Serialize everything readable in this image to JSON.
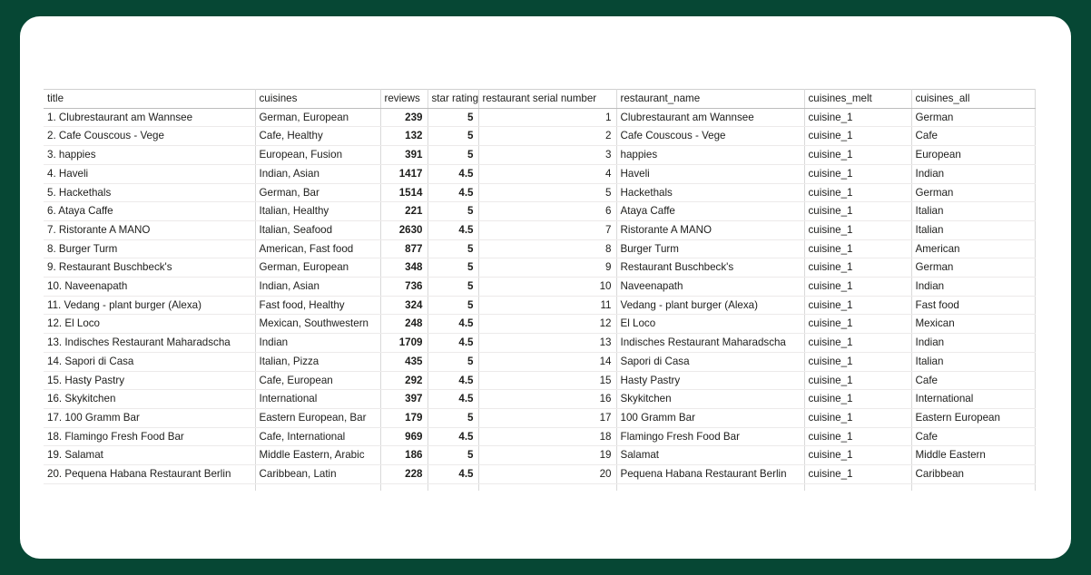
{
  "background": {
    "page_color": "#064734",
    "card_color": "#ffffff"
  },
  "spreadsheet": {
    "columns": [
      {
        "key": "title",
        "label": "title",
        "align": "left"
      },
      {
        "key": "cuisines",
        "label": "cuisines",
        "align": "left"
      },
      {
        "key": "reviews",
        "label": "reviews",
        "align": "right"
      },
      {
        "key": "star_rating",
        "label": "star rating",
        "align": "right"
      },
      {
        "key": "restaurant_serial_number",
        "label": "restaurant serial number",
        "align": "right"
      },
      {
        "key": "restaurant_name",
        "label": "restaurant_name",
        "align": "left"
      },
      {
        "key": "cuisines_melt",
        "label": "cuisines_melt",
        "align": "left"
      },
      {
        "key": "cuisines_all",
        "label": "cuisines_all",
        "align": "left"
      }
    ],
    "rows": [
      {
        "title": "1. Clubrestaurant am Wannsee",
        "cuisines": "German, European",
        "reviews": "239",
        "star_rating": "5",
        "restaurant_serial_number": "1",
        "restaurant_name": "Clubrestaurant am Wannsee",
        "cuisines_melt": "cuisine_1",
        "cuisines_all": "German"
      },
      {
        "title": "2. Cafe Couscous - Vege",
        "cuisines": "Cafe, Healthy",
        "reviews": "132",
        "star_rating": "5",
        "restaurant_serial_number": "2",
        "restaurant_name": "Cafe Couscous - Vege",
        "cuisines_melt": "cuisine_1",
        "cuisines_all": "Cafe"
      },
      {
        "title": "3. happies",
        "cuisines": "European, Fusion",
        "reviews": "391",
        "star_rating": "5",
        "restaurant_serial_number": "3",
        "restaurant_name": "happies",
        "cuisines_melt": "cuisine_1",
        "cuisines_all": "European"
      },
      {
        "title": "4. Haveli",
        "cuisines": "Indian, Asian",
        "reviews": "1417",
        "star_rating": "4.5",
        "restaurant_serial_number": "4",
        "restaurant_name": "Haveli",
        "cuisines_melt": "cuisine_1",
        "cuisines_all": "Indian"
      },
      {
        "title": "5. Hackethals",
        "cuisines": "German, Bar",
        "reviews": "1514",
        "star_rating": "4.5",
        "restaurant_serial_number": "5",
        "restaurant_name": "Hackethals",
        "cuisines_melt": "cuisine_1",
        "cuisines_all": "German"
      },
      {
        "title": "6. Ataya Caffe",
        "cuisines": "Italian, Healthy",
        "reviews": "221",
        "star_rating": "5",
        "restaurant_serial_number": "6",
        "restaurant_name": "Ataya Caffe",
        "cuisines_melt": "cuisine_1",
        "cuisines_all": "Italian"
      },
      {
        "title": "7. Ristorante A MANO",
        "cuisines": "Italian, Seafood",
        "reviews": "2630",
        "star_rating": "4.5",
        "restaurant_serial_number": "7",
        "restaurant_name": "Ristorante A MANO",
        "cuisines_melt": "cuisine_1",
        "cuisines_all": "Italian"
      },
      {
        "title": "8. Burger Turm",
        "cuisines": "American, Fast food",
        "reviews": "877",
        "star_rating": "5",
        "restaurant_serial_number": "8",
        "restaurant_name": "Burger Turm",
        "cuisines_melt": "cuisine_1",
        "cuisines_all": "American"
      },
      {
        "title": "9. Restaurant Buschbeck's",
        "cuisines": "German, European",
        "reviews": "348",
        "star_rating": "5",
        "restaurant_serial_number": "9",
        "restaurant_name": "Restaurant Buschbeck's",
        "cuisines_melt": "cuisine_1",
        "cuisines_all": "German"
      },
      {
        "title": "10. Naveenapath",
        "cuisines": "Indian, Asian",
        "reviews": "736",
        "star_rating": "5",
        "restaurant_serial_number": "10",
        "restaurant_name": "Naveenapath",
        "cuisines_melt": "cuisine_1",
        "cuisines_all": "Indian"
      },
      {
        "title": "11. Vedang - plant burger (Alexa)",
        "cuisines": "Fast food, Healthy",
        "reviews": "324",
        "star_rating": "5",
        "restaurant_serial_number": "11",
        "restaurant_name": "Vedang - plant burger (Alexa)",
        "cuisines_melt": "cuisine_1",
        "cuisines_all": "Fast food"
      },
      {
        "title": "12. El Loco",
        "cuisines": "Mexican, Southwestern",
        "reviews": "248",
        "star_rating": "4.5",
        "restaurant_serial_number": "12",
        "restaurant_name": "El Loco",
        "cuisines_melt": "cuisine_1",
        "cuisines_all": "Mexican"
      },
      {
        "title": "13. Indisches Restaurant Maharadscha",
        "cuisines": "Indian",
        "reviews": "1709",
        "star_rating": "4.5",
        "restaurant_serial_number": "13",
        "restaurant_name": "Indisches Restaurant Maharadscha",
        "cuisines_melt": "cuisine_1",
        "cuisines_all": "Indian"
      },
      {
        "title": "14. Sapori di Casa",
        "cuisines": "Italian, Pizza",
        "reviews": "435",
        "star_rating": "5",
        "restaurant_serial_number": "14",
        "restaurant_name": "Sapori di Casa",
        "cuisines_melt": "cuisine_1",
        "cuisines_all": "Italian"
      },
      {
        "title": "15. Hasty Pastry",
        "cuisines": "Cafe, European",
        "reviews": "292",
        "star_rating": "4.5",
        "restaurant_serial_number": "15",
        "restaurant_name": "Hasty Pastry",
        "cuisines_melt": "cuisine_1",
        "cuisines_all": "Cafe"
      },
      {
        "title": "16. Skykitchen",
        "cuisines": "International",
        "reviews": "397",
        "star_rating": "4.5",
        "restaurant_serial_number": "16",
        "restaurant_name": "Skykitchen",
        "cuisines_melt": "cuisine_1",
        "cuisines_all": "International"
      },
      {
        "title": "17. 100 Gramm Bar",
        "cuisines": "Eastern European, Bar",
        "reviews": "179",
        "star_rating": "5",
        "restaurant_serial_number": "17",
        "restaurant_name": "100 Gramm Bar",
        "cuisines_melt": "cuisine_1",
        "cuisines_all": "Eastern European"
      },
      {
        "title": "18. Flamingo Fresh Food Bar",
        "cuisines": "Cafe, International",
        "reviews": "969",
        "star_rating": "4.5",
        "restaurant_serial_number": "18",
        "restaurant_name": "Flamingo Fresh Food Bar",
        "cuisines_melt": "cuisine_1",
        "cuisines_all": "Cafe"
      },
      {
        "title": "19. Salamat",
        "cuisines": "Middle Eastern, Arabic",
        "reviews": "186",
        "star_rating": "5",
        "restaurant_serial_number": "19",
        "restaurant_name": "Salamat",
        "cuisines_melt": "cuisine_1",
        "cuisines_all": "Middle Eastern"
      },
      {
        "title": "20. Pequena Habana Restaurant Berlin",
        "cuisines": "Caribbean, Latin",
        "reviews": "228",
        "star_rating": "4.5",
        "restaurant_serial_number": "20",
        "restaurant_name": "Pequena Habana Restaurant Berlin",
        "cuisines_melt": "cuisine_1",
        "cuisines_all": "Caribbean"
      }
    ]
  }
}
